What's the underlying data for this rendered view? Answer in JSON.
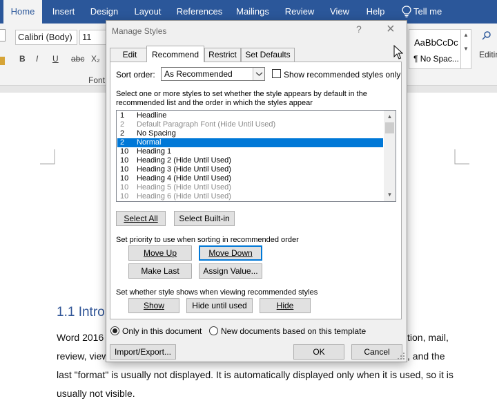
{
  "ribbon": {
    "tabs": [
      "Home",
      "Insert",
      "Design",
      "Layout",
      "References",
      "Mailings",
      "Review",
      "View",
      "Help"
    ],
    "tell_me": "Tell me",
    "font_name": "Calibri (Body)",
    "font_size": "11",
    "format_buttons": [
      "B",
      "I",
      "U",
      "abc",
      "X₂"
    ],
    "font_group": "Font",
    "style_preview": "AaBbCcDc",
    "style_name": "¶ No Spac...",
    "editing": "Editin"
  },
  "dialog": {
    "title": "Manage Styles",
    "help": "?",
    "close": "×",
    "tabs": [
      "Edit",
      "Recommend",
      "Restrict",
      "Set Defaults"
    ],
    "sort_label": "Sort order:",
    "sort_value": "As Recommended",
    "show_recommended": "Show recommended styles only",
    "instructions": [
      "Select one or more styles to set whether the style appears by default in the",
      "recommended list and the order in which the styles appear"
    ],
    "styles": [
      {
        "priority": "1",
        "name": "Headline",
        "muted": false,
        "selected": false
      },
      {
        "priority": "2",
        "name": "Default Paragraph Font  (Hide Until Used)",
        "muted": true,
        "selected": false
      },
      {
        "priority": "2",
        "name": "No Spacing",
        "muted": false,
        "selected": false
      },
      {
        "priority": "2",
        "name": "Normal",
        "muted": false,
        "selected": true
      },
      {
        "priority": "10",
        "name": "Heading 1",
        "muted": false,
        "selected": false
      },
      {
        "priority": "10",
        "name": "Heading 2  (Hide Until Used)",
        "muted": false,
        "selected": false
      },
      {
        "priority": "10",
        "name": "Heading 3  (Hide Until Used)",
        "muted": false,
        "selected": false
      },
      {
        "priority": "10",
        "name": "Heading 4  (Hide Until Used)",
        "muted": false,
        "selected": false
      },
      {
        "priority": "10",
        "name": "Heading 5  (Hide Until Used)",
        "muted": true,
        "selected": false
      },
      {
        "priority": "10",
        "name": "Heading 6  (Hide Until Used)",
        "muted": true,
        "selected": false
      }
    ],
    "select_all": "Select All",
    "select_builtin": "Select Built-in",
    "priority_label": "Set priority to use when sorting in recommended order",
    "move_up": "Move Up",
    "move_down": "Move Down",
    "make_last": "Make Last",
    "assign_value": "Assign Value...",
    "visibility_label": "Set whether style shows when viewing recommended styles",
    "show": "Show",
    "hide_until_used": "Hide until used",
    "hide": "Hide",
    "only_this_doc": "Only in this document",
    "new_docs": "New documents based on this template",
    "import_export": "Import/Export...",
    "ok": "OK",
    "cancel": "Cancel"
  },
  "document": {
    "heading": "1.1 Intro",
    "lines": [
      {
        "left": "Word 2016",
        "right": "tion, mail,"
      },
      {
        "left": "review, view",
        "right": ", and the"
      },
      {
        "left": "last \"format\" is usually not displayed. It is automatically displayed only when it is used, so it is",
        "right": ""
      },
      {
        "left": "usually not visible.",
        "right": ""
      }
    ]
  },
  "colors": {
    "ribbon_blue": "#2b579a",
    "selection": "#0078d7",
    "heading_blue": "#2f5496"
  }
}
